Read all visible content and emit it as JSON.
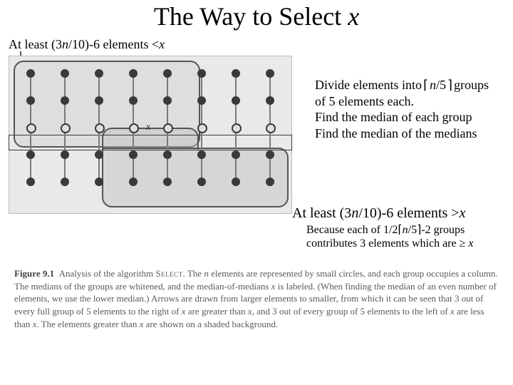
{
  "title_prefix": "The Way to Select ",
  "title_var": "x",
  "upper_label_prefix": "At least (3",
  "upper_label_n": "n",
  "upper_label_mid": "/10)-6 elements <",
  "upper_label_x": "x",
  "right": {
    "l1a": "Divide elements into",
    "l1b": "n",
    "l1c": "/5",
    "l1d": "groups",
    "l2": "of 5 elements each.",
    "l3": "Find the median of each group",
    "l4": "Find the median of the medians"
  },
  "lower": {
    "title_prefix": "At least (3",
    "title_n": "n",
    "title_mid": "/10)-6 elements >",
    "title_x": "x",
    "note_a": "Because each of 1/2",
    "note_b": "n",
    "note_c": "/5",
    "note_d": "-2 groups",
    "note_e": "contributes 3 elements which are ",
    "note_ge": "≥",
    "note_f": " x"
  },
  "caption": {
    "label": "Figure 9.1",
    "text_a": "  Analysis of the algorithm ",
    "select": "Select",
    "text_b": ". The ",
    "n1": "n",
    "text_c": " elements are represented by small circles, and each group occupies a column. The medians of the groups are whitened, and the median-of-medians ",
    "x1": "x",
    "text_d": " is labeled. (When finding the median of an even number of elements, we use the lower median.) Arrows are drawn from larger elements to smaller, from which it can be seen that 3 out of every full group of 5 elements to the right of ",
    "x2": "x",
    "text_e": " are greater than ",
    "x3": "x",
    "text_f": ", and 3 out of every group of 5 elements to the left of ",
    "x4": "x",
    "text_g": " are less than ",
    "x5": "x",
    "text_h": ". The elements greater than ",
    "x6": "x",
    "text_i": " are shown on a shaded background."
  },
  "diagram": {
    "x_label": "x",
    "columns": 8,
    "rows": 5,
    "median_row_index": 2,
    "median_of_medians_col": 3
  },
  "pagenum": ""
}
